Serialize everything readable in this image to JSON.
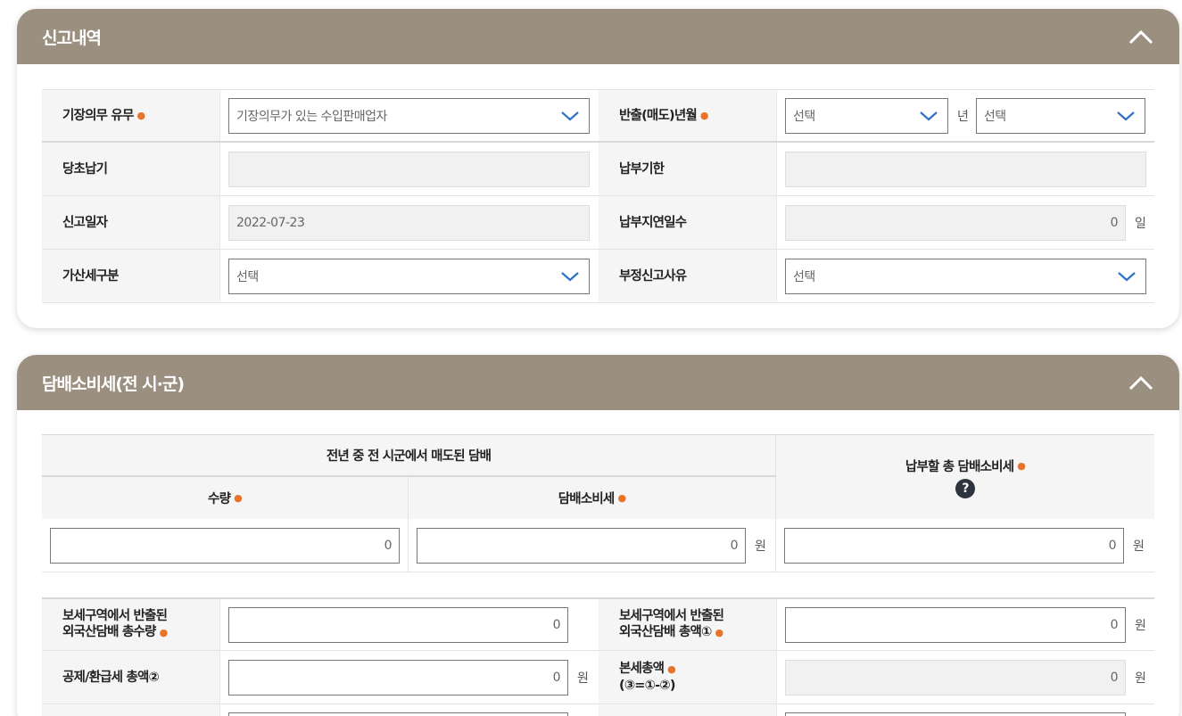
{
  "section1": {
    "title": "신고내역",
    "rows": {
      "bookkeeping": {
        "label": "기장의무 유무",
        "value": "기장의무가 있는 수입판매업자"
      },
      "release": {
        "label": "반출(매도)년월",
        "year_value": "선택",
        "year_unit": "년",
        "month_value": "선택"
      },
      "original_payment": {
        "label": "당초납기",
        "value": ""
      },
      "due_date": {
        "label": "납부기한",
        "value": ""
      },
      "report_date": {
        "label": "신고일자",
        "value": "2022-07-23"
      },
      "late_days": {
        "label": "납부지연일수",
        "value": "0",
        "unit": "일"
      },
      "penalty_type": {
        "label": "가산세구분",
        "value": "선택"
      },
      "improper_reason": {
        "label": "부정신고사유",
        "value": "선택"
      }
    }
  },
  "section2": {
    "title": "담배소비세(전 시·군)",
    "group_header": "전년 중 전 시군에서 매도된 담배",
    "col_quantity": "수량",
    "col_tax": "담배소비세",
    "col_total": "납부할 총 담배소비세",
    "help_icon": "?",
    "quantity_value": "0",
    "tax_value": "0",
    "tax_unit": "원",
    "total_value": "0",
    "total_unit": "원",
    "bonded_qty": {
      "label_line1": "보세구역에서 반출된",
      "label_line2": "외국산담배 총수량",
      "value": "0"
    },
    "bonded_amt": {
      "label_line1": "보세구역에서 반출된",
      "label_line2": "외국산담배 총액①",
      "value": "0",
      "unit": "원"
    },
    "deduction": {
      "label": "공제/환급세 총액②",
      "value": "0",
      "unit": "원"
    },
    "main_tax": {
      "label_line1": "본세총액",
      "label_line2": "(③=①-②)",
      "value": "0",
      "unit": "원"
    }
  },
  "colors": {
    "header_bg": "#9b9080",
    "required": "#e8742b",
    "chevron": "#2f6fc9"
  }
}
